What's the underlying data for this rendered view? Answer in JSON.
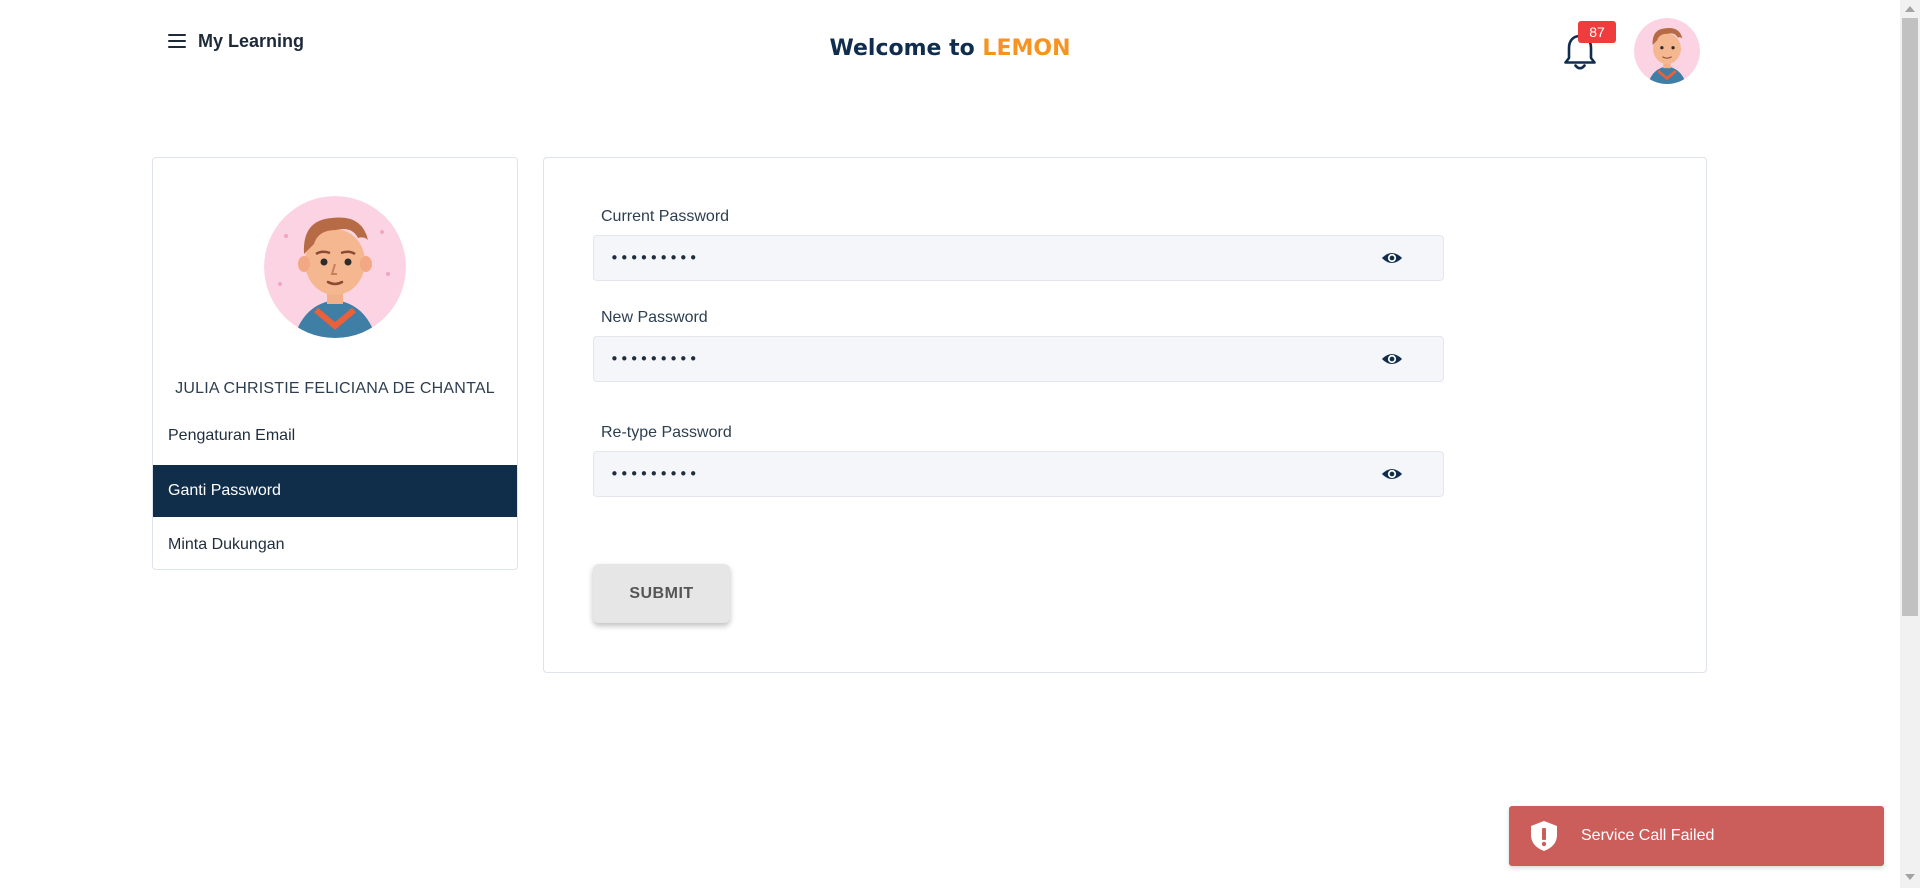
{
  "header": {
    "menu_label": "My Learning",
    "welcome_prefix": "Welcome to",
    "brand": "LEMON",
    "notification_count": "87"
  },
  "profile": {
    "name": "JULIA CHRISTIE FELICIANA DE CHANTAL"
  },
  "sidebar": {
    "items": [
      {
        "label": "Pengaturan Email",
        "active": false
      },
      {
        "label": "Ganti Password",
        "active": true
      },
      {
        "label": "Minta Dukungan",
        "active": false
      }
    ]
  },
  "form": {
    "current_password": {
      "label": "Current Password",
      "value": "•••••••••"
    },
    "new_password": {
      "label": "New Password",
      "value": "•••••••••"
    },
    "retype_password": {
      "label": "Re-type Password",
      "value": "•••••••••"
    },
    "submit_label": "SUBMIT"
  },
  "toast": {
    "message": "Service Call Failed"
  },
  "colors": {
    "brand_orange": "#f7931e",
    "navy": "#102d4a",
    "badge_red": "#ef3d3d",
    "toast_red": "#cb5e5a"
  },
  "icons": [
    "menu-icon",
    "bell-icon",
    "eye-icon",
    "alert-shield-icon"
  ]
}
